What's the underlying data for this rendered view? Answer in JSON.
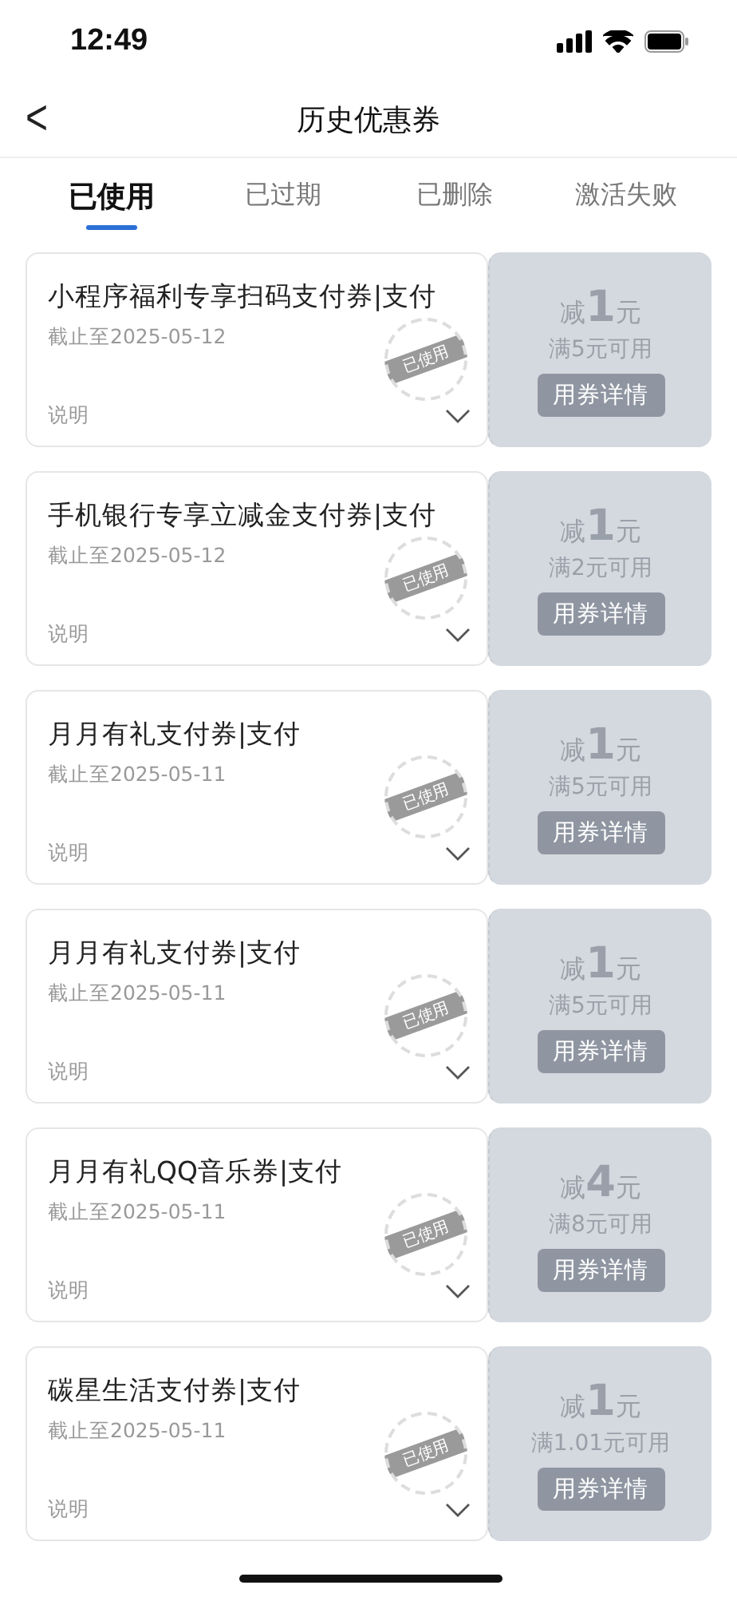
{
  "status_bar": {
    "time": "12:49"
  },
  "nav": {
    "back": "<",
    "title": "历史优惠券"
  },
  "tabs": [
    {
      "label": "已使用",
      "selected": true
    },
    {
      "label": "已过期",
      "selected": false
    },
    {
      "label": "已删除",
      "selected": false
    },
    {
      "label": "激活失败",
      "selected": false
    }
  ],
  "coupons": [
    {
      "title": "小程序福利专享扫码支付券|支付",
      "deadline": "截止至2025-05-12",
      "note": "说明",
      "stamp": "已使用",
      "discount": "减**1**元",
      "condition": "满5元可用",
      "button": "用券详情"
    },
    {
      "title": "手机银行专享立减金支付券|支付",
      "deadline": "截止至2025-05-12",
      "note": "说明",
      "stamp": "已使用",
      "discount": "减**1**元",
      "condition": "满2元可用",
      "button": "用券详情"
    },
    {
      "title": "月月有礼支付券|支付",
      "deadline": "截止至2025-05-11",
      "note": "说明",
      "stamp": "已使用",
      "discount": "减**1**元",
      "condition": "满5元可用",
      "button": "用券详情"
    },
    {
      "title": "月月有礼支付券|支付",
      "deadline": "截止至2025-05-11",
      "note": "说明",
      "stamp": "已使用",
      "discount": "减**1**元",
      "condition": "满5元可用",
      "button": "用券详情"
    },
    {
      "title": "月月有礼QQ音乐券|支付",
      "deadline": "截止至2025-05-11",
      "note": "说明",
      "stamp": "已使用",
      "discount": "减**4**元",
      "condition": "满8元可用",
      "button": "用券详情"
    },
    {
      "title": "碳星生活支付券|支付",
      "deadline": "截止至2025-05-11",
      "note": "说明",
      "stamp": "已使用",
      "discount": "减**1**元",
      "condition": "满1.01元可用",
      "button": "用券详情"
    }
  ]
}
